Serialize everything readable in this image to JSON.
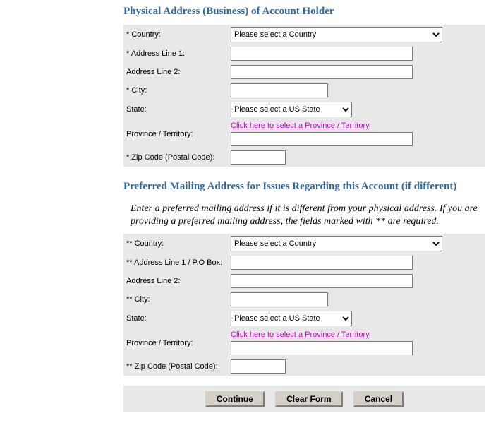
{
  "physical": {
    "heading": "Physical Address (Business) of Account Holder",
    "fields": {
      "country_label": "* Country:",
      "country_select_default": "Please select a Country",
      "address1_label": "* Address Line 1:",
      "address1_value": "",
      "address2_label": "Address Line 2:",
      "address2_value": "",
      "city_label": "* City:",
      "city_value": "",
      "state_label": "State:",
      "state_select_default": "Please select a US State",
      "province_label": "Province / Territory:",
      "province_link": "Click here to select a Province / Territory",
      "province_value": "",
      "zip_label": "* Zip Code (Postal Code):",
      "zip_value": ""
    }
  },
  "mailing": {
    "heading": "Preferred Mailing Address for Issues Regarding this Account (if different)",
    "instruction": "Enter a preferred mailing address if it is different from your physical address. If you are providing a preferred mailing address, the fields marked with ** are required.",
    "fields": {
      "country_label": "** Country:",
      "country_select_default": "Please select a Country",
      "address1_label": "** Address Line 1 / P.O Box:",
      "address1_value": "",
      "address2_label": "Address Line 2:",
      "address2_value": "",
      "city_label": "** City:",
      "city_value": "",
      "state_label": "State:",
      "state_select_default": "Please select a US State",
      "province_label": "Province / Territory:",
      "province_link": "Click here to select a Province / Territory",
      "province_value": "",
      "zip_label": "** Zip Code (Postal Code):",
      "zip_value": ""
    }
  },
  "buttons": {
    "continue": "Continue",
    "clear": "Clear Form",
    "cancel": "Cancel"
  }
}
